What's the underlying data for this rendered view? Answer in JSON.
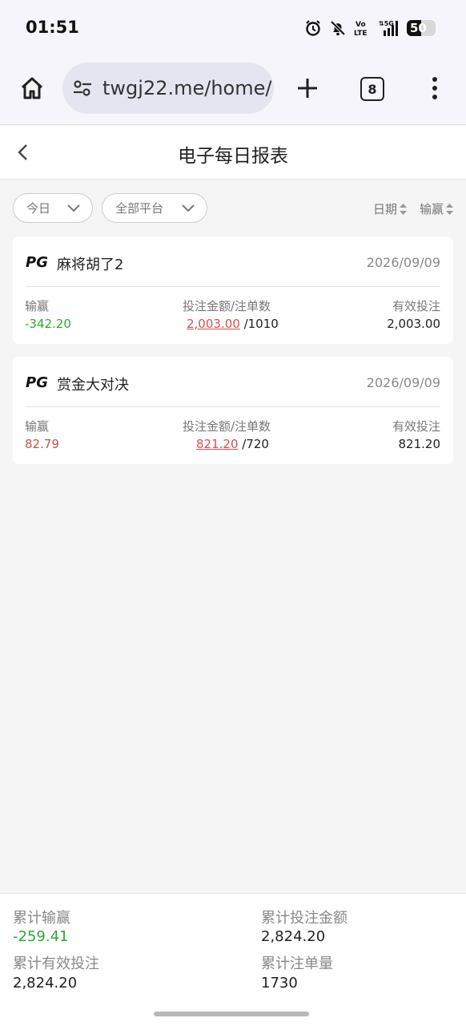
{
  "status_bar": {
    "time": "01:51",
    "battery_level": "50",
    "battery_fraction": 0.5,
    "network": "5G",
    "volte": "Vo LTE"
  },
  "browser": {
    "url": "twgj22.me/home/",
    "tab_count": "8"
  },
  "header": {
    "title": "电子每日报表"
  },
  "filters": {
    "period": "今日",
    "platform": "全部平台",
    "sort_date": "日期",
    "sort_winloss": "输赢"
  },
  "records": [
    {
      "provider": "PG",
      "name": "麻将胡了2",
      "date": "2026/09/09",
      "winloss_label": "输赢",
      "winloss": "-342.20",
      "winloss_color": "#2ea82e",
      "bet_label": "投注金额/注单数",
      "bet_amount": "2,003.00",
      "bet_count": "/1010",
      "valid_label": "有效投注",
      "valid_bet": "2,003.00"
    },
    {
      "provider": "PG",
      "name": "赏金大对决",
      "date": "2026/09/09",
      "winloss_label": "输赢",
      "winloss": "82.79",
      "winloss_color": "#c0554a",
      "bet_label": "投注金额/注单数",
      "bet_amount": "821.20",
      "bet_count": "/720",
      "valid_label": "有效投注",
      "valid_bet": "821.20"
    }
  ],
  "summary": {
    "total_winloss_label": "累计输赢",
    "total_winloss": "-259.41",
    "total_winloss_color": "#2ea82e",
    "total_bet_label": "累计投注金额",
    "total_bet": "2,824.20",
    "total_valid_label": "累计有效投注",
    "total_valid": "2,824.20",
    "total_count_label": "累计注单量",
    "total_count": "1730"
  }
}
